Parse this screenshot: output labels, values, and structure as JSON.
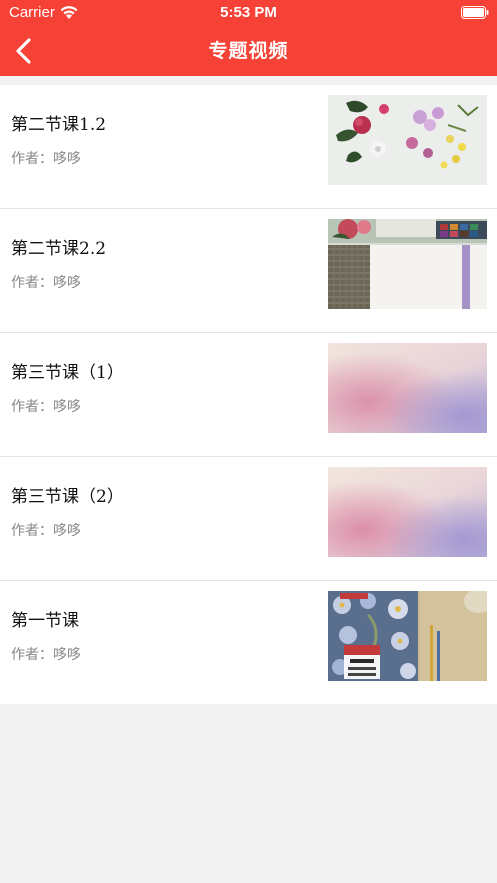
{
  "status_bar": {
    "carrier": "Carrier",
    "time": "5:53 PM"
  },
  "nav": {
    "title": "专题视频",
    "back_icon": "chevron-left-icon",
    "accent_color": "#f64136"
  },
  "videos": [
    {
      "title": "第二节课1.2",
      "author": "作者：哆哆",
      "thumbnail": "flowers-photo"
    },
    {
      "title": "第二节课2.2",
      "author": "作者：哆哆",
      "thumbnail": "paints-photo"
    },
    {
      "title": "第三节课（1）",
      "author": "作者：哆哆",
      "thumbnail": "blurred-gradient"
    },
    {
      "title": "第三节课（2）",
      "author": "作者：哆哆",
      "thumbnail": "blurred-gradient"
    },
    {
      "title": "第一节课",
      "author": "作者：哆哆",
      "thumbnail": "book-cover-photo"
    }
  ]
}
